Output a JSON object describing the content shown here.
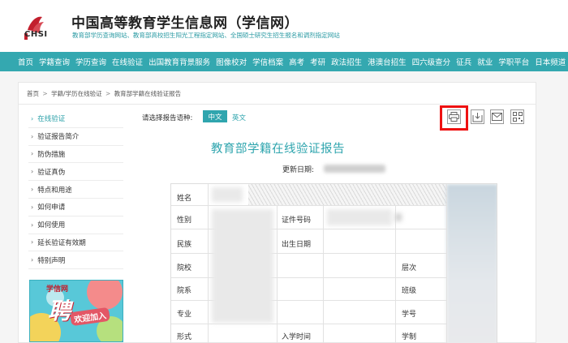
{
  "header": {
    "logo_text": "CHSI",
    "site_title": "中国高等教育学生信息网（学信网）",
    "site_subtitle": "教育部学历查询网站、教育部高校招生阳光工程指定网站、全国硕士研究生招生报名和调剂指定网站"
  },
  "nav": [
    "首页",
    "学籍查询",
    "学历查询",
    "在线验证",
    "出国教育背景服务",
    "图像校对",
    "学信档案",
    "高考",
    "考研",
    "政法招生",
    "港澳台招生",
    "四六级查分",
    "征兵",
    "就业",
    "学职平台",
    "日本频道"
  ],
  "breadcrumb": [
    "首页",
    "学籍/学历在线验证",
    "教育部学籍在线验证报告"
  ],
  "breadcrumb_sep": ">",
  "sidebar": {
    "items": [
      {
        "label": "在线验证",
        "active": true
      },
      {
        "label": "验证报告简介",
        "active": false
      },
      {
        "label": "防伪措施",
        "active": false
      },
      {
        "label": "验证真伪",
        "active": false
      },
      {
        "label": "特点和用途",
        "active": false
      },
      {
        "label": "如何申请",
        "active": false
      },
      {
        "label": "如何使用",
        "active": false
      },
      {
        "label": "延长验证有效期",
        "active": false
      },
      {
        "label": "特别声明",
        "active": false
      }
    ],
    "banner": {
      "logo": "学信网",
      "big": "聘",
      "sub": "欢迎加入"
    }
  },
  "language": {
    "label": "请选择报告语种:",
    "options": [
      "中文",
      "英文"
    ],
    "selected": "中文"
  },
  "toolbar": {
    "icons": [
      "print-icon",
      "download-icon",
      "email-icon",
      "qrcode-icon"
    ]
  },
  "report": {
    "title": "教育部学籍在线验证报告",
    "update_label": "更新日期:"
  },
  "table": {
    "labels": {
      "name": "姓名",
      "gender": "性别",
      "ethnicity": "民族",
      "school": "院校",
      "department": "院系",
      "major": "专业",
      "form": "形式",
      "id_number": "证件号码",
      "birth_date": "出生日期",
      "entry_time": "入学时间",
      "level": "层次",
      "class": "班级",
      "student_no": "学号",
      "length": "学制"
    }
  },
  "colors": {
    "teal": "#34a8b0",
    "highlight": "#ee1111",
    "logo_red": "#c21f2d"
  }
}
